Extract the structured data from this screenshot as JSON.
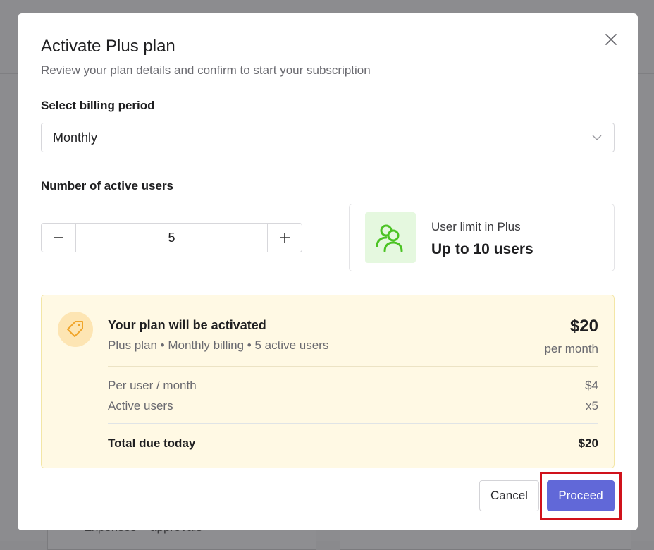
{
  "background": {
    "partial_text": "Expenses + approvals"
  },
  "modal": {
    "title": "Activate Plus plan",
    "subtitle": "Review your plan details and confirm to start your subscription",
    "close_icon": "close-icon"
  },
  "billing": {
    "label": "Select billing period",
    "selected": "Monthly",
    "chevron_icon": "chevron-down-icon"
  },
  "users": {
    "label": "Number of active users",
    "count": "5",
    "decrement_icon": "minus-icon",
    "increment_icon": "plus-icon"
  },
  "limit": {
    "icon": "users-icon",
    "label": "User limit in Plus",
    "value": "Up to 10 users",
    "icon_color": "#4cc324",
    "icon_bg": "#e5f8df"
  },
  "summary": {
    "icon": "tag-icon",
    "title": "Your plan will be activated",
    "subtitle": "Plus plan • Monthly billing • 5 active users",
    "price": "$20",
    "price_period": "per month",
    "rows": [
      {
        "label": "Per user / month",
        "value": "$4"
      },
      {
        "label": "Active users",
        "value": "x5"
      }
    ],
    "total_label": "Total due today",
    "total_value": "$20",
    "bg_color": "#fff9e4",
    "icon_color": "#f0a52a"
  },
  "actions": {
    "cancel_label": "Cancel",
    "proceed_label": "Proceed",
    "proceed_color": "#6168d8",
    "highlight_color": "#d0121b"
  }
}
